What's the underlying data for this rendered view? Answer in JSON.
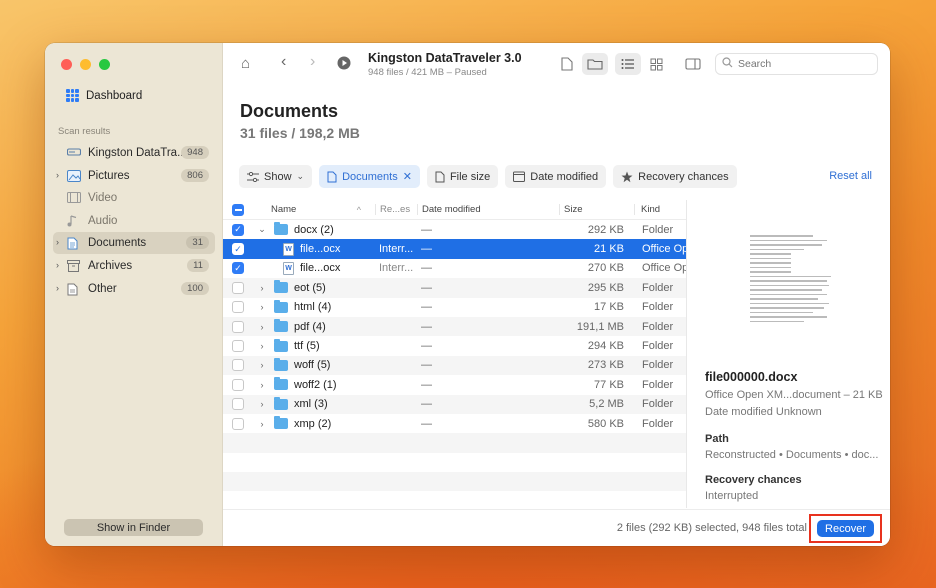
{
  "sidebar": {
    "dashboard": "Dashboard",
    "scan_results_label": "Scan results",
    "items": [
      {
        "label": "Kingston DataTra...",
        "count": "948",
        "icon": "drive-icon",
        "chevron": false,
        "dim": false
      },
      {
        "label": "Pictures",
        "count": "806",
        "icon": "picture-icon",
        "chevron": true,
        "dim": false
      },
      {
        "label": "Video",
        "count": "",
        "icon": "film-icon",
        "chevron": false,
        "dim": true
      },
      {
        "label": "Audio",
        "count": "",
        "icon": "music-icon",
        "chevron": false,
        "dim": true
      },
      {
        "label": "Documents",
        "count": "31",
        "icon": "document-icon",
        "chevron": true,
        "dim": false,
        "active": true
      },
      {
        "label": "Archives",
        "count": "11",
        "icon": "archive-icon",
        "chevron": true,
        "dim": false
      },
      {
        "label": "Other",
        "count": "100",
        "icon": "other-icon",
        "chevron": true,
        "dim": false
      }
    ],
    "finder_button": "Show in Finder"
  },
  "toolbar": {
    "title": "Kingston DataTraveler 3.0",
    "subtitle": "948 files / 421 MB – Paused",
    "search_placeholder": "Search"
  },
  "main": {
    "heading": "Documents",
    "subheading": "31 files / 198,2 MB",
    "filters": {
      "show": "Show",
      "documents": "Documents",
      "file_size": "File size",
      "date_modified": "Date modified",
      "recovery_chances": "Recovery chances",
      "reset_all": "Reset all"
    }
  },
  "table": {
    "headers": {
      "name": "Name",
      "rec": "Re...es",
      "date": "Date modified",
      "size": "Size",
      "kind": "Kind"
    },
    "rows": [
      {
        "name": "docx (2)",
        "rec": "",
        "date": "—",
        "size": "292 KB",
        "kind": "Folder",
        "checked": true,
        "type": "folder",
        "expanded": true,
        "indent": 0
      },
      {
        "name": "file...ocx",
        "rec": "Interr...",
        "date": "—",
        "size": "21 KB",
        "kind": "Office Op...",
        "checked": true,
        "type": "doc",
        "selected": true,
        "indent": 1
      },
      {
        "name": "file...ocx",
        "rec": "Interr...",
        "date": "—",
        "size": "270 KB",
        "kind": "Office Op...",
        "checked": true,
        "type": "doc",
        "indent": 1
      },
      {
        "name": "eot (5)",
        "rec": "",
        "date": "—",
        "size": "295 KB",
        "kind": "Folder",
        "checked": false,
        "type": "folder",
        "indent": 0
      },
      {
        "name": "html (4)",
        "rec": "",
        "date": "—",
        "size": "17 KB",
        "kind": "Folder",
        "checked": false,
        "type": "folder",
        "indent": 0
      },
      {
        "name": "pdf (4)",
        "rec": "",
        "date": "—",
        "size": "191,1 MB",
        "kind": "Folder",
        "checked": false,
        "type": "folder",
        "indent": 0
      },
      {
        "name": "ttf (5)",
        "rec": "",
        "date": "—",
        "size": "294 KB",
        "kind": "Folder",
        "checked": false,
        "type": "folder",
        "indent": 0
      },
      {
        "name": "woff (5)",
        "rec": "",
        "date": "—",
        "size": "273 KB",
        "kind": "Folder",
        "checked": false,
        "type": "folder",
        "indent": 0
      },
      {
        "name": "woff2 (1)",
        "rec": "",
        "date": "—",
        "size": "77 KB",
        "kind": "Folder",
        "checked": false,
        "type": "folder",
        "indent": 0
      },
      {
        "name": "xml (3)",
        "rec": "",
        "date": "—",
        "size": "5,2 MB",
        "kind": "Folder",
        "checked": false,
        "type": "folder",
        "indent": 0
      },
      {
        "name": "xmp (2)",
        "rec": "",
        "date": "—",
        "size": "580 KB",
        "kind": "Folder",
        "checked": false,
        "type": "folder",
        "indent": 0
      }
    ]
  },
  "preview": {
    "file_name": "file000000.docx",
    "type_line": "Office Open XM...document – 21 KB",
    "date_line": "Date modified  Unknown",
    "path_label": "Path",
    "path_value": "Reconstructed • Documents • doc...",
    "recovery_label": "Recovery chances",
    "recovery_value": "Interrupted"
  },
  "status": {
    "text": "2 files (292 KB) selected, 948 files total",
    "recover_button": "Recover"
  },
  "colors": {
    "accent": "#1f6fe5",
    "highlight_box": "#e8321e",
    "sidebar_bg": "#ece6d5"
  }
}
